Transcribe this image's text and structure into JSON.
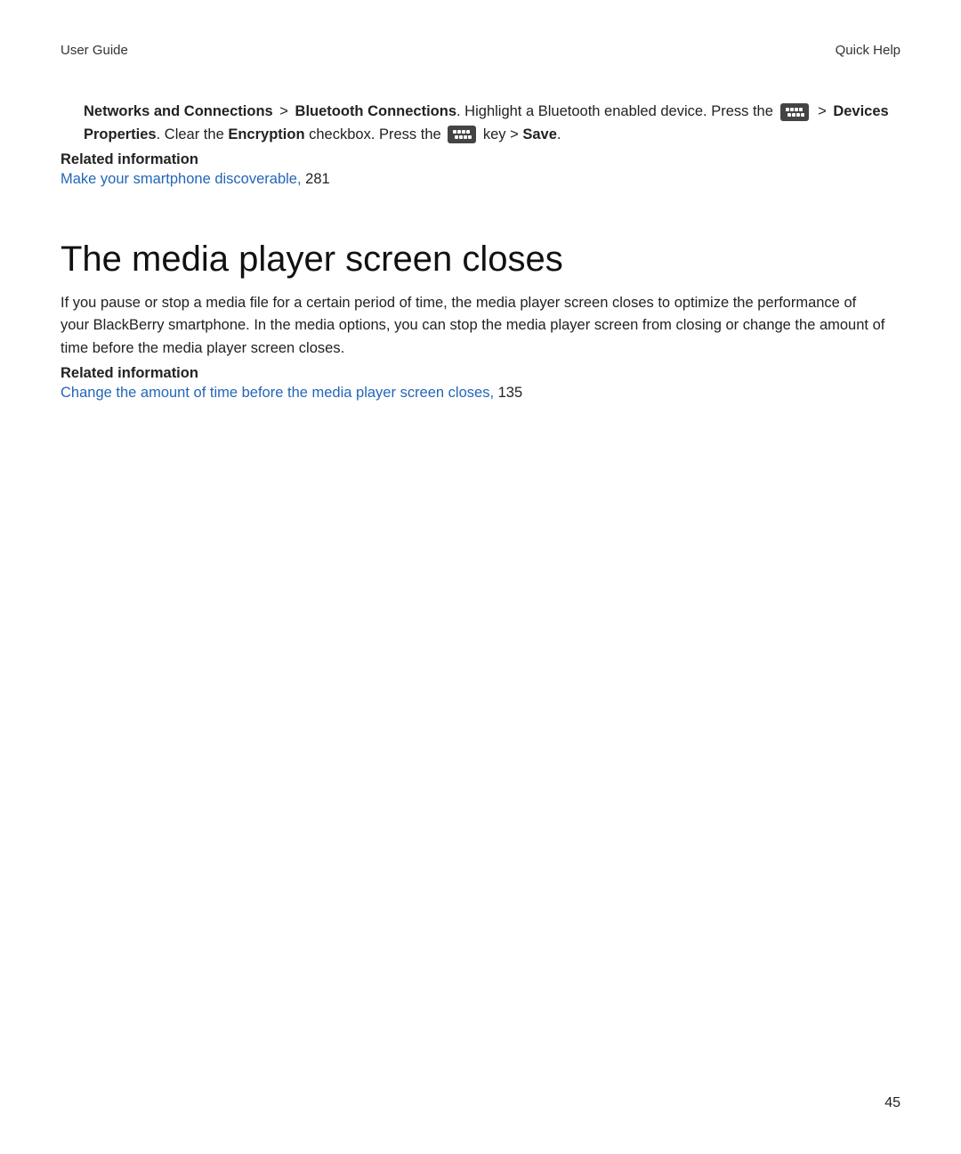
{
  "header": {
    "left": "User Guide",
    "right": "Quick Help"
  },
  "section1": {
    "instr": {
      "bold1": "Networks and Connections",
      "gt1": ">",
      "bold2": "Bluetooth Connections",
      "text1": ". Highlight a Bluetooth enabled device. Press the ",
      "gt2": ">",
      "bold3": "Devices Properties",
      "text2": ". Clear the ",
      "bold4": "Encryption",
      "text3": " checkbox. Press the ",
      "text4": " key > ",
      "bold5": "Save",
      "text5": "."
    },
    "related_heading": "Related information",
    "related_link": "Make your smartphone discoverable, ",
    "related_page": "281"
  },
  "section2": {
    "title": "The media player screen closes",
    "body": "If you pause or stop a media file for a certain period of time, the media player screen closes to optimize the performance of your BlackBerry smartphone. In the media options, you can stop the media player screen from closing or change the amount of time before the media player screen closes.",
    "related_heading": "Related information",
    "related_link": "Change the amount of time before the media player screen closes, ",
    "related_page": "135"
  },
  "page_number": "45"
}
